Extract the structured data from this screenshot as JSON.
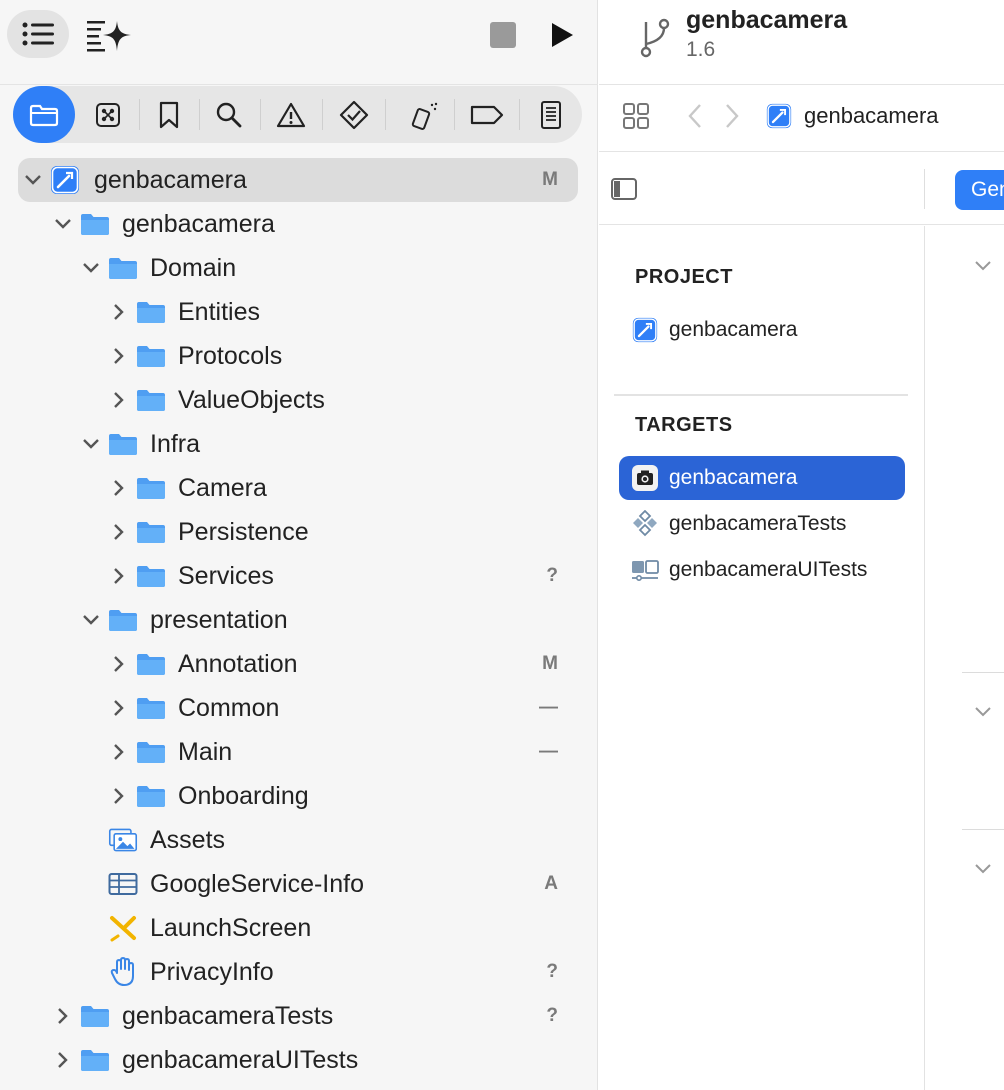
{
  "toolbar": {
    "navigator_toggle_icon": "list-icon",
    "ai_icon": "sparkle-icon",
    "stop_icon": "stop-icon",
    "run_icon": "play-icon"
  },
  "navigator_tabs": [
    {
      "name": "project-navigator",
      "icon": "folder-icon",
      "active": true
    },
    {
      "name": "source-control-navigator",
      "icon": "source-control-icon"
    },
    {
      "name": "bookmark-navigator",
      "icon": "bookmark-icon"
    },
    {
      "name": "find-navigator",
      "icon": "search-icon"
    },
    {
      "name": "issue-navigator",
      "icon": "warning-icon"
    },
    {
      "name": "test-navigator",
      "icon": "test-diamond-icon"
    },
    {
      "name": "debug-navigator",
      "icon": "spray-icon"
    },
    {
      "name": "breakpoint-navigator",
      "icon": "breakpoint-tag-icon"
    },
    {
      "name": "report-navigator",
      "icon": "report-icon"
    }
  ],
  "tree": {
    "root": {
      "label": "genbacamera",
      "badge": "M"
    },
    "items": [
      {
        "label": "genbacamera",
        "badge": "",
        "depth": 1,
        "expanded": true,
        "kind": "folder"
      },
      {
        "label": "Domain",
        "badge": "",
        "depth": 2,
        "expanded": true,
        "kind": "folder"
      },
      {
        "label": "Entities",
        "badge": "",
        "depth": 3,
        "expanded": false,
        "kind": "folder"
      },
      {
        "label": "Protocols",
        "badge": "",
        "depth": 3,
        "expanded": false,
        "kind": "folder"
      },
      {
        "label": "ValueObjects",
        "badge": "",
        "depth": 3,
        "expanded": false,
        "kind": "folder"
      },
      {
        "label": "Infra",
        "badge": "",
        "depth": 2,
        "expanded": true,
        "kind": "folder"
      },
      {
        "label": "Camera",
        "badge": "",
        "depth": 3,
        "expanded": false,
        "kind": "folder"
      },
      {
        "label": "Persistence",
        "badge": "",
        "depth": 3,
        "expanded": false,
        "kind": "folder"
      },
      {
        "label": "Services",
        "badge": "?",
        "depth": 3,
        "expanded": false,
        "kind": "folder"
      },
      {
        "label": "presentation",
        "badge": "",
        "depth": 2,
        "expanded": true,
        "kind": "folder"
      },
      {
        "label": "Annotation",
        "badge": "M",
        "depth": 3,
        "expanded": false,
        "kind": "folder"
      },
      {
        "label": "Common",
        "badge": "—",
        "depth": 3,
        "expanded": false,
        "kind": "folder"
      },
      {
        "label": "Main",
        "badge": "—",
        "depth": 3,
        "expanded": false,
        "kind": "folder"
      },
      {
        "label": "Onboarding",
        "badge": "",
        "depth": 3,
        "expanded": false,
        "kind": "folder"
      },
      {
        "label": "Assets",
        "badge": "",
        "depth": 2,
        "kind": "assets"
      },
      {
        "label": "GoogleService-Info",
        "badge": "A",
        "depth": 2,
        "kind": "plist"
      },
      {
        "label": "LaunchScreen",
        "badge": "",
        "depth": 2,
        "kind": "storyboard"
      },
      {
        "label": "PrivacyInfo",
        "badge": "?",
        "depth": 2,
        "kind": "privacy"
      },
      {
        "label": "genbacameraTests",
        "badge": "?",
        "depth": 1,
        "expanded": false,
        "kind": "folder"
      },
      {
        "label": "genbacameraUITests",
        "badge": "",
        "depth": 1,
        "expanded": false,
        "kind": "folder"
      }
    ]
  },
  "window": {
    "project_name": "genbacamera",
    "version": "1.6"
  },
  "jumpbar": {
    "crumb_label": "genbacamera"
  },
  "editor": {
    "active_tab": "Gen"
  },
  "project_section": {
    "header": "PROJECT",
    "items": [
      {
        "label": "genbacamera"
      }
    ]
  },
  "targets_section": {
    "header": "TARGETS",
    "items": [
      {
        "label": "genbacamera",
        "selected": true
      },
      {
        "label": "genbacameraTests",
        "selected": false
      },
      {
        "label": "genbacameraUITests",
        "selected": false
      }
    ]
  },
  "colors": {
    "accent": "#2f7ff7",
    "selection": "#2b64d6",
    "folder": "#5aa9f5",
    "badge": "#7a7a7a"
  }
}
